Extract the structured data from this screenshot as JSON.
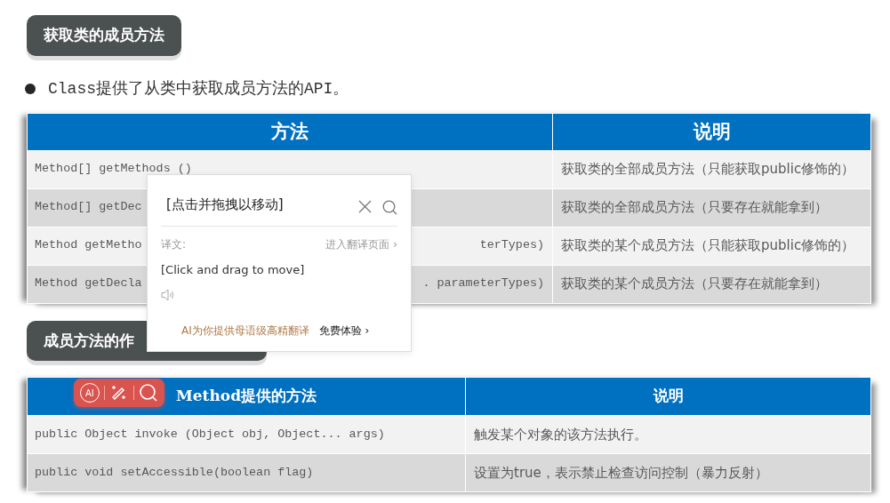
{
  "heading": {
    "text": "获取类的成员方法"
  },
  "bullet": {
    "text": "Class提供了从类中获取成员方法的API。"
  },
  "methods_table": {
    "columns": [
      "方法",
      "说明"
    ],
    "rows": [
      {
        "method": {
          "before": "Method[] getMethods ()"
        },
        "description": "获取类的全部成员方法（只能获取public修饰的）"
      },
      {
        "method": {
          "before": "Method[] getDec"
        },
        "description": "获取类的全部成员方法（只要存在就能拿到）"
      },
      {
        "method": {
          "before": "Method getMetho",
          "after": "terTypes)"
        },
        "description": "获取类的某个成员方法（只能获取public修饰的）"
      },
      {
        "method": {
          "before": "Method getDecla",
          "after": ". parameterTypes)"
        },
        "description": "获取类的某个成员方法（只要存在就能拿到）"
      }
    ]
  },
  "section_heading": {
    "text": "成员方法的作"
  },
  "method_table": {
    "columns": [
      "Method提供的方法",
      "说明"
    ],
    "rows": [
      {
        "method": {
          "before": "public Object invoke (Object obj, Object... args)"
        },
        "description": "触发某个对象的该方法执行。"
      },
      {
        "method": {
          "before": "public void  setAccessible(boolean flag)"
        },
        "description": "设置为true，表示禁止检查访问控制（暴力反射）"
      }
    ]
  },
  "translation_popup": {
    "source": "[点击并拖拽以移动]",
    "label": "译文:",
    "page_link": "进入翻译页面 ›",
    "result": "[Click and drag to move]",
    "promo": "AI为你提供母语级高精翻译",
    "promo_link": "免费体验 ›"
  },
  "ai_toolbar": {
    "ai_label": "AI"
  }
}
